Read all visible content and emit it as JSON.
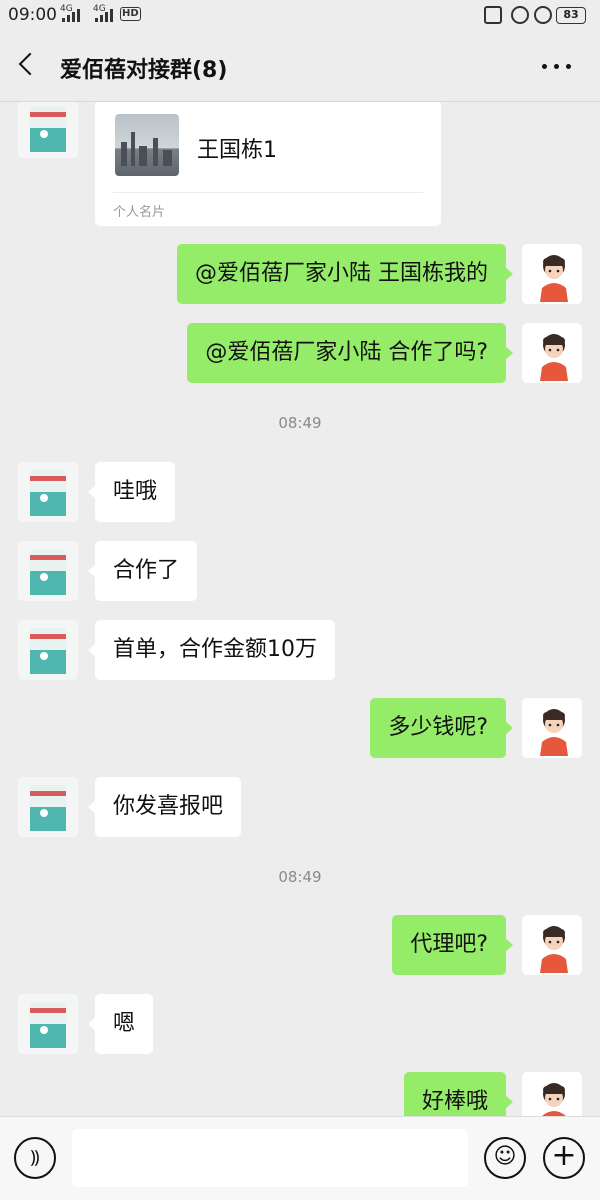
{
  "status_bar": {
    "time": "09:00",
    "net1": "4G",
    "net2": "4G",
    "hd": "HD",
    "battery": "83"
  },
  "header": {
    "title": "爱佰蓓对接群(8)"
  },
  "messages": [
    {
      "side": "in",
      "type": "card",
      "name": "王国栋1",
      "card_label": "个人名片"
    },
    {
      "side": "out",
      "text": "@爱佰蓓厂家小陆  王国栋我的"
    },
    {
      "side": "out",
      "text": "@爱佰蓓厂家小陆  合作了吗?"
    },
    {
      "type": "time",
      "text": "08:49"
    },
    {
      "side": "in",
      "text": "哇哦"
    },
    {
      "side": "in",
      "text": "合作了"
    },
    {
      "side": "in",
      "text": "首单，合作金额10万"
    },
    {
      "side": "out",
      "text": "多少钱呢?"
    },
    {
      "side": "in",
      "text": "你发喜报吧"
    },
    {
      "type": "time",
      "text": "08:49"
    },
    {
      "side": "out",
      "text": "代理吧?"
    },
    {
      "side": "in",
      "text": "嗯"
    },
    {
      "side": "out",
      "text": "好棒哦"
    }
  ],
  "input_bar": {
    "voice_icon": "voice-icon",
    "emoji_icon": "emoji-icon",
    "plus_icon": "plus-icon"
  },
  "colors": {
    "outgoing_bubble": "#95ec69",
    "incoming_bubble": "#ffffff",
    "background": "#ededed"
  }
}
